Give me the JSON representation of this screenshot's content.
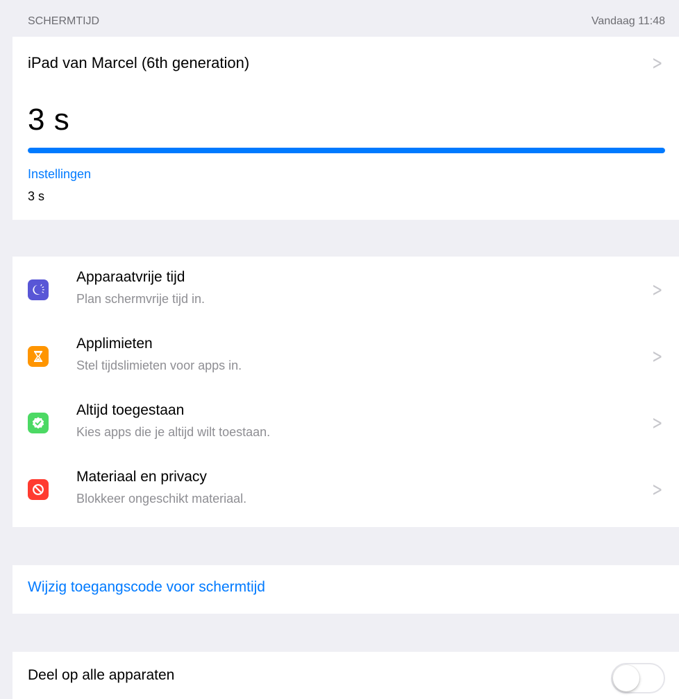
{
  "header": {
    "section_title": "SCHERMTIJD",
    "timestamp": "Vandaag 11:48"
  },
  "usage": {
    "device_name": "iPad van Marcel (6th generation)",
    "total_time": "3 s",
    "progress_percent": 100,
    "category_label": "Instellingen",
    "category_value": "3 s",
    "accent_color": "#007aff"
  },
  "features": [
    {
      "title": "Apparaatvrije tijd",
      "subtitle": "Plan schermvrije tijd in.",
      "icon": "downtime-icon",
      "color": "#5856d6"
    },
    {
      "title": "Applimieten",
      "subtitle": "Stel tijdslimieten voor apps in.",
      "icon": "hourglass-icon",
      "color": "#ff9500"
    },
    {
      "title": "Altijd toegestaan",
      "subtitle": "Kies apps die je altijd wilt toestaan.",
      "icon": "checkmark-badge-icon",
      "color": "#4cd964"
    },
    {
      "title": "Materiaal en privacy",
      "subtitle": "Blokkeer ongeschikt materiaal.",
      "icon": "restriction-icon",
      "color": "#ff3b30"
    }
  ],
  "passcode": {
    "label": "Wijzig toegangscode voor schermtijd"
  },
  "share": {
    "label": "Deel op alle apparaten",
    "enabled": false
  }
}
